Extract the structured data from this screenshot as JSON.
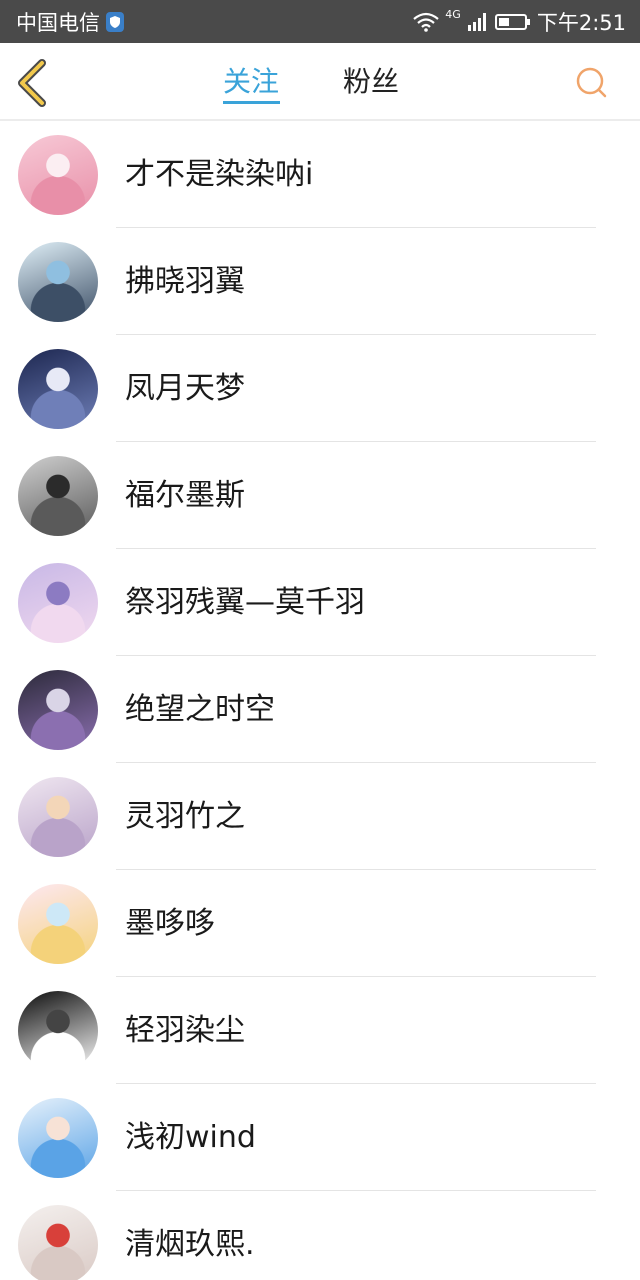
{
  "status_bar": {
    "carrier": "中国电信",
    "network": "4G",
    "time": "下午2:51"
  },
  "header": {
    "tabs": [
      {
        "label": "关注",
        "active": true
      },
      {
        "label": "粉丝",
        "active": false
      }
    ]
  },
  "colors": {
    "accent": "#3aa3d9",
    "back_arrow": "#f2c94c",
    "search": "#f0a46a",
    "status_bar": "#4a4a4a"
  },
  "users": [
    {
      "name": "才不是染染呐i",
      "avatar": "pink-anime-girl-avatar",
      "colors": [
        "#f7c9d6",
        "#e88fa8",
        "#fbeef2"
      ]
    },
    {
      "name": "拂晓羽翼",
      "avatar": "anime-girl-blue-hat-avatar",
      "colors": [
        "#dfeff7",
        "#3d4f66",
        "#8fbfe0"
      ]
    },
    {
      "name": "凤月天梦",
      "avatar": "night-moon-girl-avatar",
      "colors": [
        "#1d2750",
        "#6f7fb8",
        "#e7e9f6"
      ]
    },
    {
      "name": "福尔墨斯",
      "avatar": "grey-hair-boy-avatar",
      "colors": [
        "#cfcfcf",
        "#5a5a5a",
        "#2b2b2b"
      ]
    },
    {
      "name": "祭羽残翼—莫千羽",
      "avatar": "purple-sky-silhouette-avatar",
      "colors": [
        "#c8b8e6",
        "#f1d9ef",
        "#8c7bc2"
      ]
    },
    {
      "name": "绝望之时空",
      "avatar": "dark-purple-tree-avatar",
      "colors": [
        "#2c2a3a",
        "#8b6fb0",
        "#d9d4e6"
      ]
    },
    {
      "name": "灵羽竹之",
      "avatar": "silver-hair-girl-avatar",
      "colors": [
        "#efe6f0",
        "#b9a3c9",
        "#f3d6b8"
      ]
    },
    {
      "name": "墨哆哆",
      "avatar": "pastel-chibi-avatar",
      "colors": [
        "#fde8f2",
        "#f4d27a",
        "#cde8f7"
      ]
    },
    {
      "name": "轻羽染尘",
      "avatar": "black-calligraphy-avatar",
      "colors": [
        "#0c0c0c",
        "#ffffff",
        "#444444"
      ]
    },
    {
      "name": "浅初wind",
      "avatar": "blue-hair-girl-avatar",
      "colors": [
        "#e6f1fb",
        "#5aa3e6",
        "#f7e2d6"
      ]
    },
    {
      "name": "清烟玖熙.",
      "avatar": "white-hair-girl-avatar",
      "colors": [
        "#f4f0ee",
        "#d9c9c4",
        "#d8403a"
      ]
    }
  ]
}
